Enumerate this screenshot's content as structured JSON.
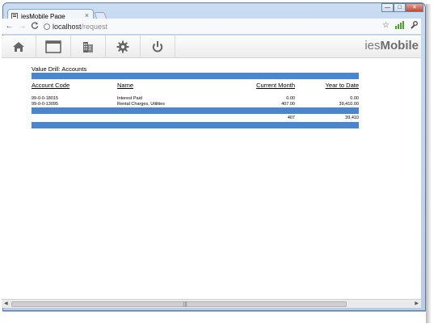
{
  "browser": {
    "tab_title": "iesMobile Page",
    "tab_close": "×",
    "url_host": "localhost",
    "url_path": "/request",
    "window_controls": {
      "minimize": "—",
      "maximize": "□",
      "close": "✕"
    },
    "nav": {
      "back": "←",
      "forward": "→",
      "reload": "C"
    },
    "star": "☆",
    "wrench": "🔧"
  },
  "app": {
    "brand_prefix": "ies",
    "brand_bold": "Mobile",
    "toolbar_icons": [
      "home-icon",
      "window-icon",
      "building-icon",
      "gear-icon",
      "power-icon"
    ]
  },
  "report": {
    "title": "Value Drill: Accounts",
    "columns": {
      "code": "Account Code",
      "name": "Name",
      "current_month": "Current Month",
      "ytd": "Year to Date"
    },
    "rows": [
      {
        "code": "99-0-0-18015",
        "name": "Interest Paid",
        "current_month": "0.00",
        "ytd": "0.00"
      },
      {
        "code": "99-0-0-13095",
        "name": "Rental Charges, Utilities",
        "current_month": "407.00",
        "ytd": "39,410.00"
      }
    ],
    "totals": {
      "current_month": "407",
      "ytd": "39,410"
    },
    "accent_color": "#4a86cf"
  },
  "scrollbar": {
    "left_arrow": "◀",
    "right_arrow": "▶",
    "grip": "|||"
  }
}
